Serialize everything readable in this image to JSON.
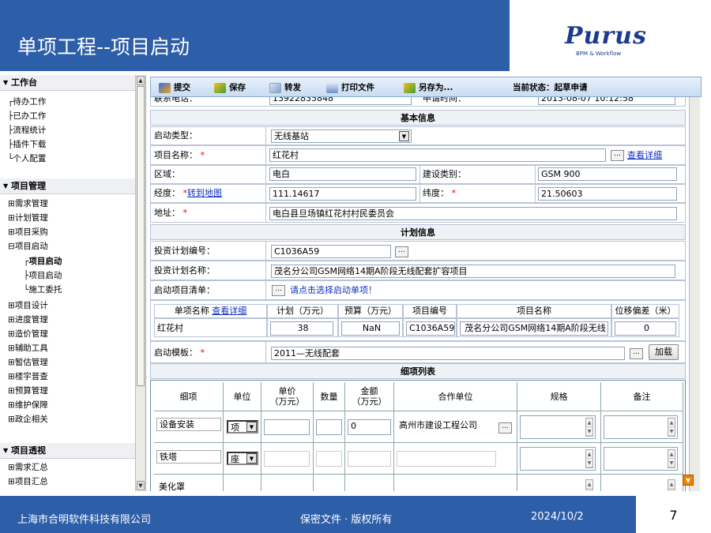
{
  "header": {
    "title": "单项工程--项目启动",
    "logo": "Purus",
    "logo_sub": "BPM & Workflow"
  },
  "footer": {
    "company": "上海市合明软件科技有限公司",
    "confidential": "保密文件 · 版权所有",
    "date": "2024/10/2",
    "page": "7"
  },
  "sidebar": {
    "sections": [
      {
        "label": "工作台",
        "items": [
          "待办工作",
          "已办工作",
          "流程统计",
          "插件下载",
          "个人配置"
        ]
      },
      {
        "label": "项目管理",
        "items": [
          "需求管理",
          "计划管理",
          "项目采购",
          "项目启动",
          "项目启动",
          "项目启动",
          "施工委托",
          "项目设计",
          "进度管理",
          "造价管理",
          "辅助工具",
          "暂估管理",
          "楼宇普查",
          "预算管理",
          "维护保障",
          "政企相关"
        ]
      },
      {
        "label": "项目透视",
        "items": [
          "需求汇总",
          "项目汇总"
        ]
      }
    ]
  },
  "toolbar": {
    "submit": "提交",
    "save": "保存",
    "forward": "转发",
    "print": "打印文件",
    "save_as": "另存为...",
    "status": "当前状态：起草申请"
  },
  "form": {
    "partial_row": {
      "phone_label": "联系电话：",
      "phone_value": "13922835848",
      "time_label": "申请时间：",
      "time_value": "2013-08-07 10:12:58"
    },
    "basic_info": "基本信息",
    "start_type_label": "启动类型：",
    "start_type_value": "无线基站",
    "project_name_label": "项目名称：",
    "project_name_value": "红花村",
    "view_detail": "查看详细",
    "region_label": "区域：",
    "region_value": "电白",
    "build_type_label": "建设类别：",
    "build_type_value": "GSM 900",
    "longitude_label": "经度：",
    "goto_map": "转到地图",
    "longitude_value": "111.14617",
    "latitude_label": "纬度：",
    "latitude_value": "21.50603",
    "address_label": "地址：",
    "address_value": "电白县旦场镇红花村村民委员会",
    "plan_info": "计划信息",
    "plan_no_label": "投资计划编号：",
    "plan_no_value": "C1036A59",
    "plan_name_label": "投资计划名称：",
    "plan_name_value": "茂名分公司GSM网络14期A阶段无线配套扩容项目",
    "start_list_label": "启动项目清单：",
    "start_list_hint": "请点击选择启动单项！",
    "list_headers": [
      "单项名称",
      "计划（万元）",
      "预算（万元）",
      "项目编号",
      "项目名称",
      "位移偏差（米）"
    ],
    "list_view_detail": "查看详细",
    "list_row": [
      "红花村",
      "38",
      "NaN",
      "C1036A59",
      "茂名分公司GSM网络14期A阶段无线",
      "0"
    ],
    "template_label": "启动模板：",
    "template_value": "2011—无线配套",
    "load_button": "加载",
    "detail_list": "细项列表",
    "detail_headers": [
      "细项",
      "单位",
      "单价\n（万元）",
      "数量",
      "金额\n（万元）",
      "合作单位",
      "规格",
      "备注"
    ],
    "detail_rows": [
      {
        "item": "设备安装",
        "unit": "项",
        "amount": "0",
        "partner": "高州市建设工程公司"
      },
      {
        "item": "铁塔",
        "unit": "座",
        "amount": "",
        "partner": ""
      },
      {
        "item": "美化罩",
        "unit": "",
        "amount": "",
        "partner": ""
      }
    ]
  },
  "colors": {
    "header_bg": "#2d5ea8",
    "toolbar_bg": "#c8dcf2",
    "required": "#ee0000",
    "link": "#1030c0"
  }
}
